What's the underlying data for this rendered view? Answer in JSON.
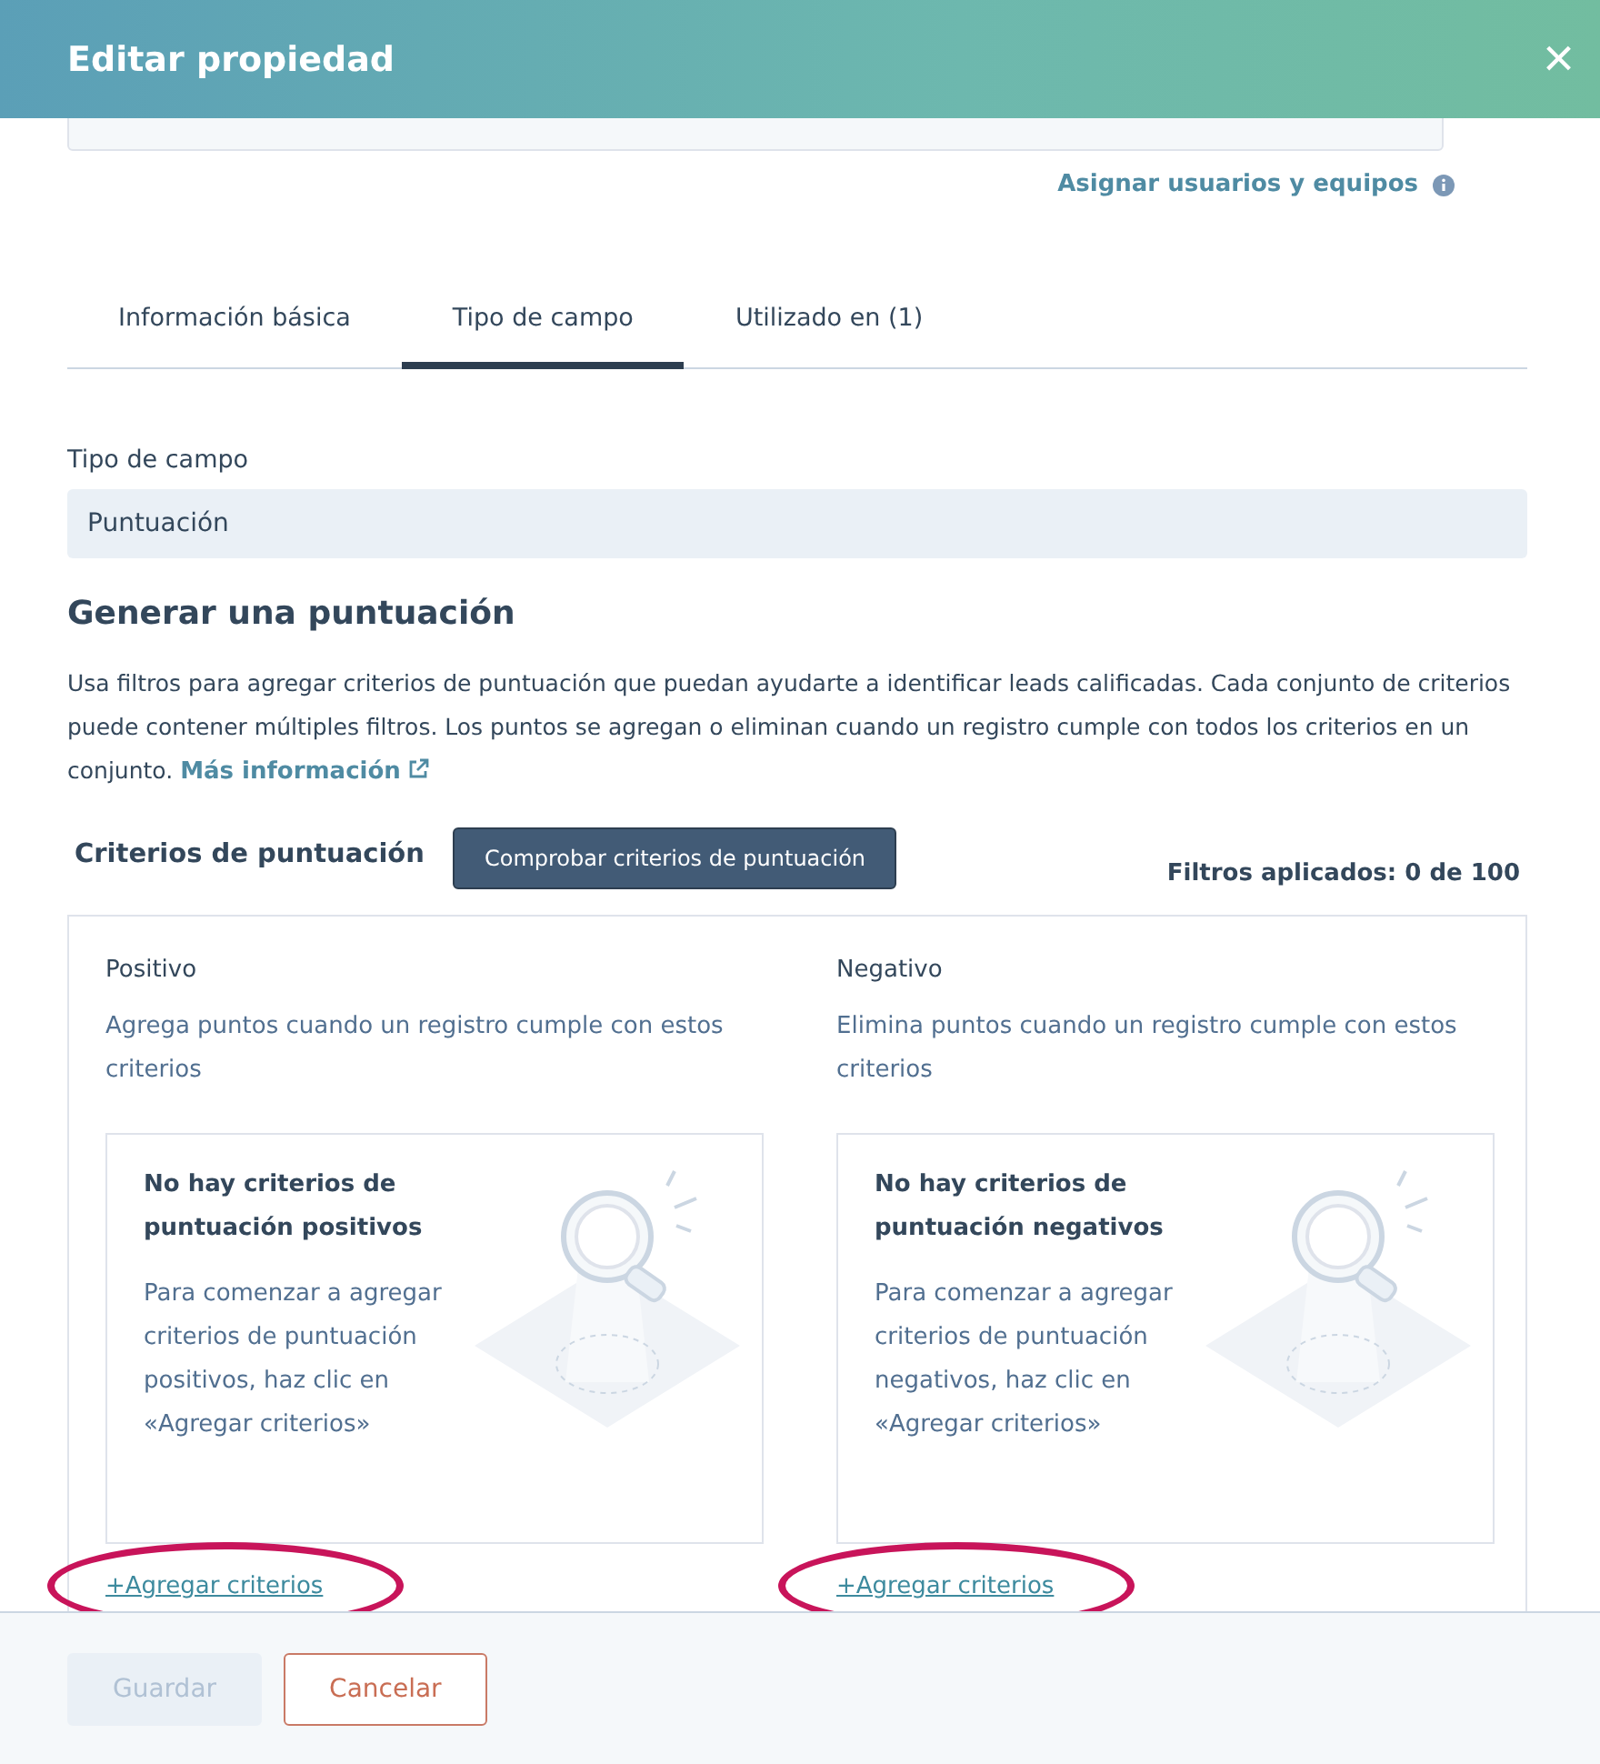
{
  "header": {
    "title": "Editar propiedad",
    "close": "×"
  },
  "assign_link": "Asignar usuarios y equipos",
  "tabs": [
    {
      "label": "Información básica",
      "selected": false
    },
    {
      "label": "Tipo de campo",
      "selected": true
    },
    {
      "label": "Utilizado en (1)",
      "selected": false
    }
  ],
  "field_type": {
    "label": "Tipo de campo",
    "value": "Puntuación"
  },
  "section": {
    "title": "Generar una puntuación",
    "description": "Usa filtros para agregar criterios de puntuación que puedan ayudarte a identificar leads calificadas. Cada conjunto de criterios puede contener múltiples filtros. Los puntos se agregan o eliminan cuando un registro cumple con todos los criterios en un conjunto.",
    "link": "Más información"
  },
  "criteria": {
    "title": "Criterios de puntuación",
    "test_button": "Comprobar criterios de puntuación",
    "applied": "Filtros aplicados: 0 de 100"
  },
  "columns": [
    {
      "title": "Positivo",
      "description": "Agrega puntos cuando un registro cumple con estos criterios",
      "empty_title": "No hay criterios de puntuación positivos",
      "empty_text": "Para comenzar a agregar criterios de puntuación positivos, haz clic en «Agregar criterios»",
      "add": "+Agregar criterios",
      "highlighted": true
    },
    {
      "title": "Negativo",
      "description": "Elimina puntos cuando un registro cumple con estos criterios",
      "empty_title": "No hay criterios de puntuación negativos",
      "empty_text": "Para comenzar a agregar criterios de puntuación negativos, haz clic en «Agregar criterios»",
      "add": "+Agregar criterios",
      "highlighted": true
    }
  ],
  "footer": [
    {
      "label": "Guardar",
      "kind": "primary",
      "disabled": true
    },
    {
      "label": "Cancelar",
      "kind": "secondary",
      "disabled": false
    }
  ]
}
